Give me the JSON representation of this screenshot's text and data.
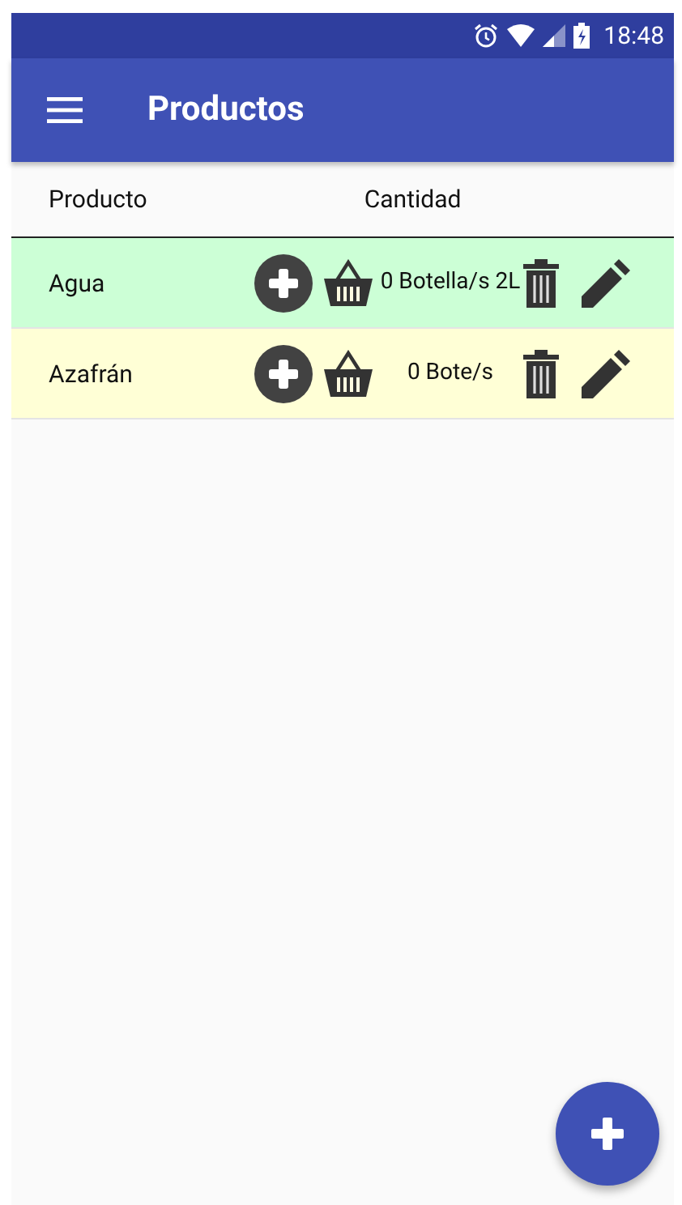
{
  "status_bar": {
    "time": "18:48"
  },
  "app_bar": {
    "title": "Productos"
  },
  "table": {
    "columns": [
      "Producto",
      "Cantidad"
    ],
    "rows": [
      {
        "name": "Agua",
        "quantity": "0 Botella/s 2L",
        "color": "#ccffd6"
      },
      {
        "name": "Azafrán",
        "quantity": "0 Bote/s",
        "color": "#ffffd6"
      }
    ]
  }
}
